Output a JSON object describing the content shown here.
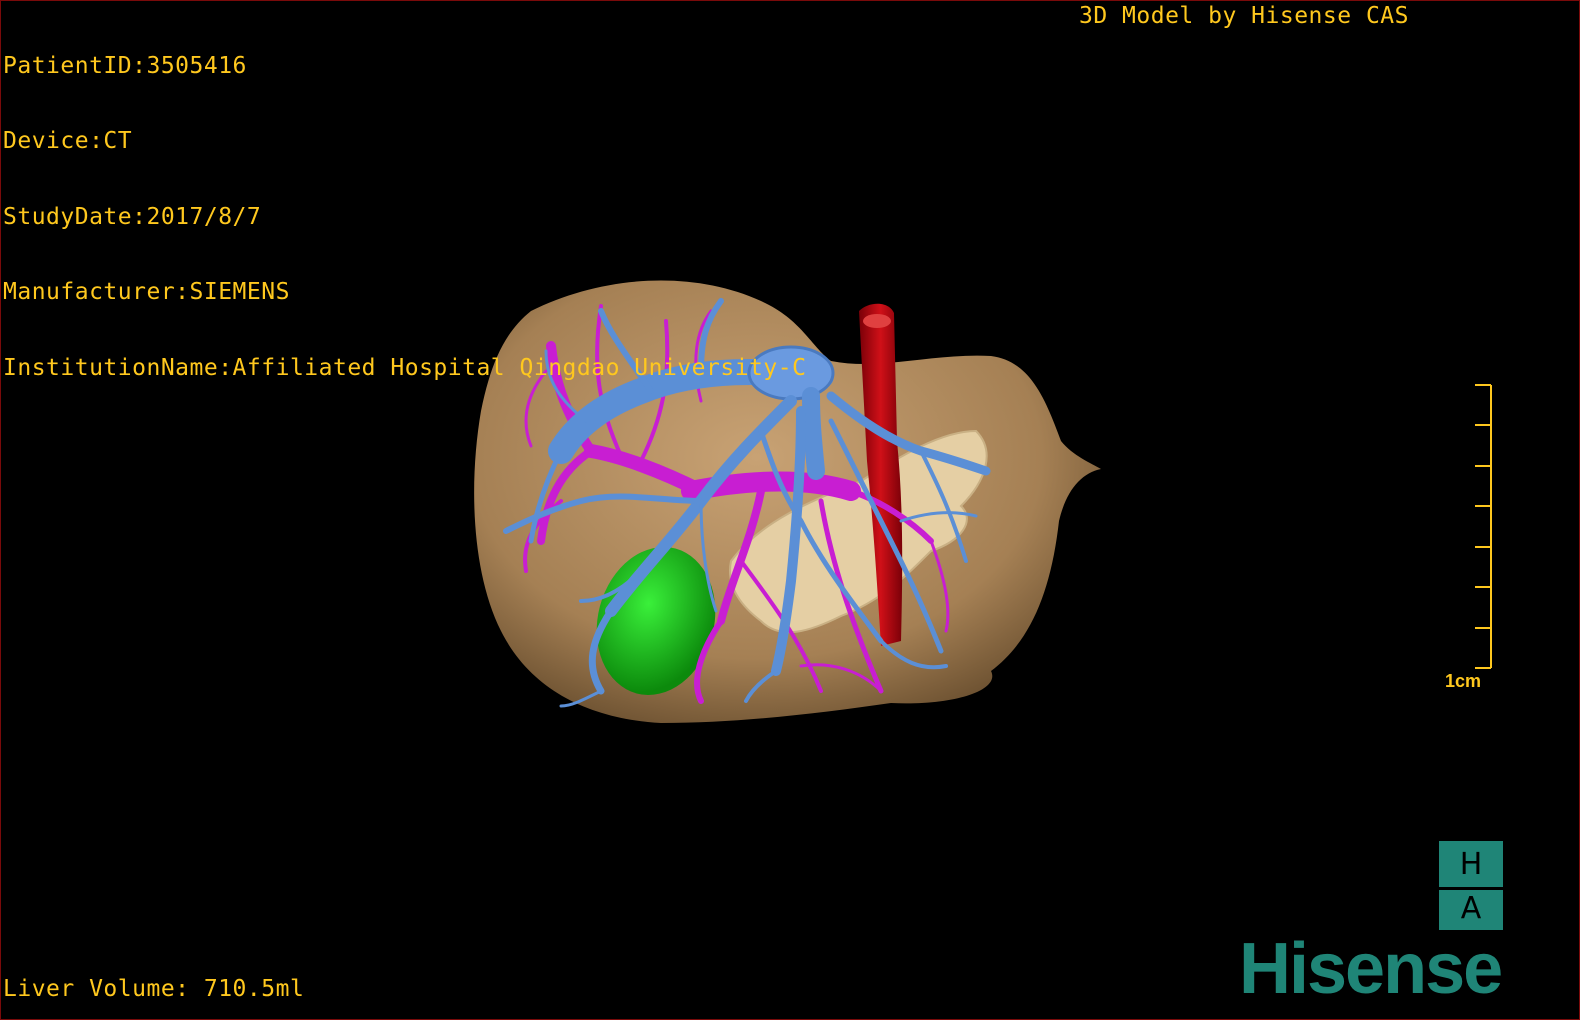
{
  "overlay": {
    "patient_id": "PatientID:3505416",
    "device": "Device:CT",
    "study_date": "StudyDate:2017/8/7",
    "manufacturer": "Manufacturer:SIEMENS",
    "institution": "InstitutionName:Affiliated Hospital Qingdao University-C",
    "model_credit": "3D Model by Hisense CAS",
    "liver_volume": "Liver Volume: 710.5ml"
  },
  "scale": {
    "label": "1cm"
  },
  "logo": {
    "ha_top": "H",
    "ha_bottom": "A",
    "brand": "Hisense"
  },
  "colors": {
    "overlay_text": "#ffc81e",
    "liver": "#b08a5c",
    "hepatic_vein": "#5b8fd6",
    "portal_vein": "#c81ed2",
    "aorta": "#b0000a",
    "tumor": "#16c416",
    "pancreas": "#e8d2a8",
    "brand": "#1f8577"
  }
}
